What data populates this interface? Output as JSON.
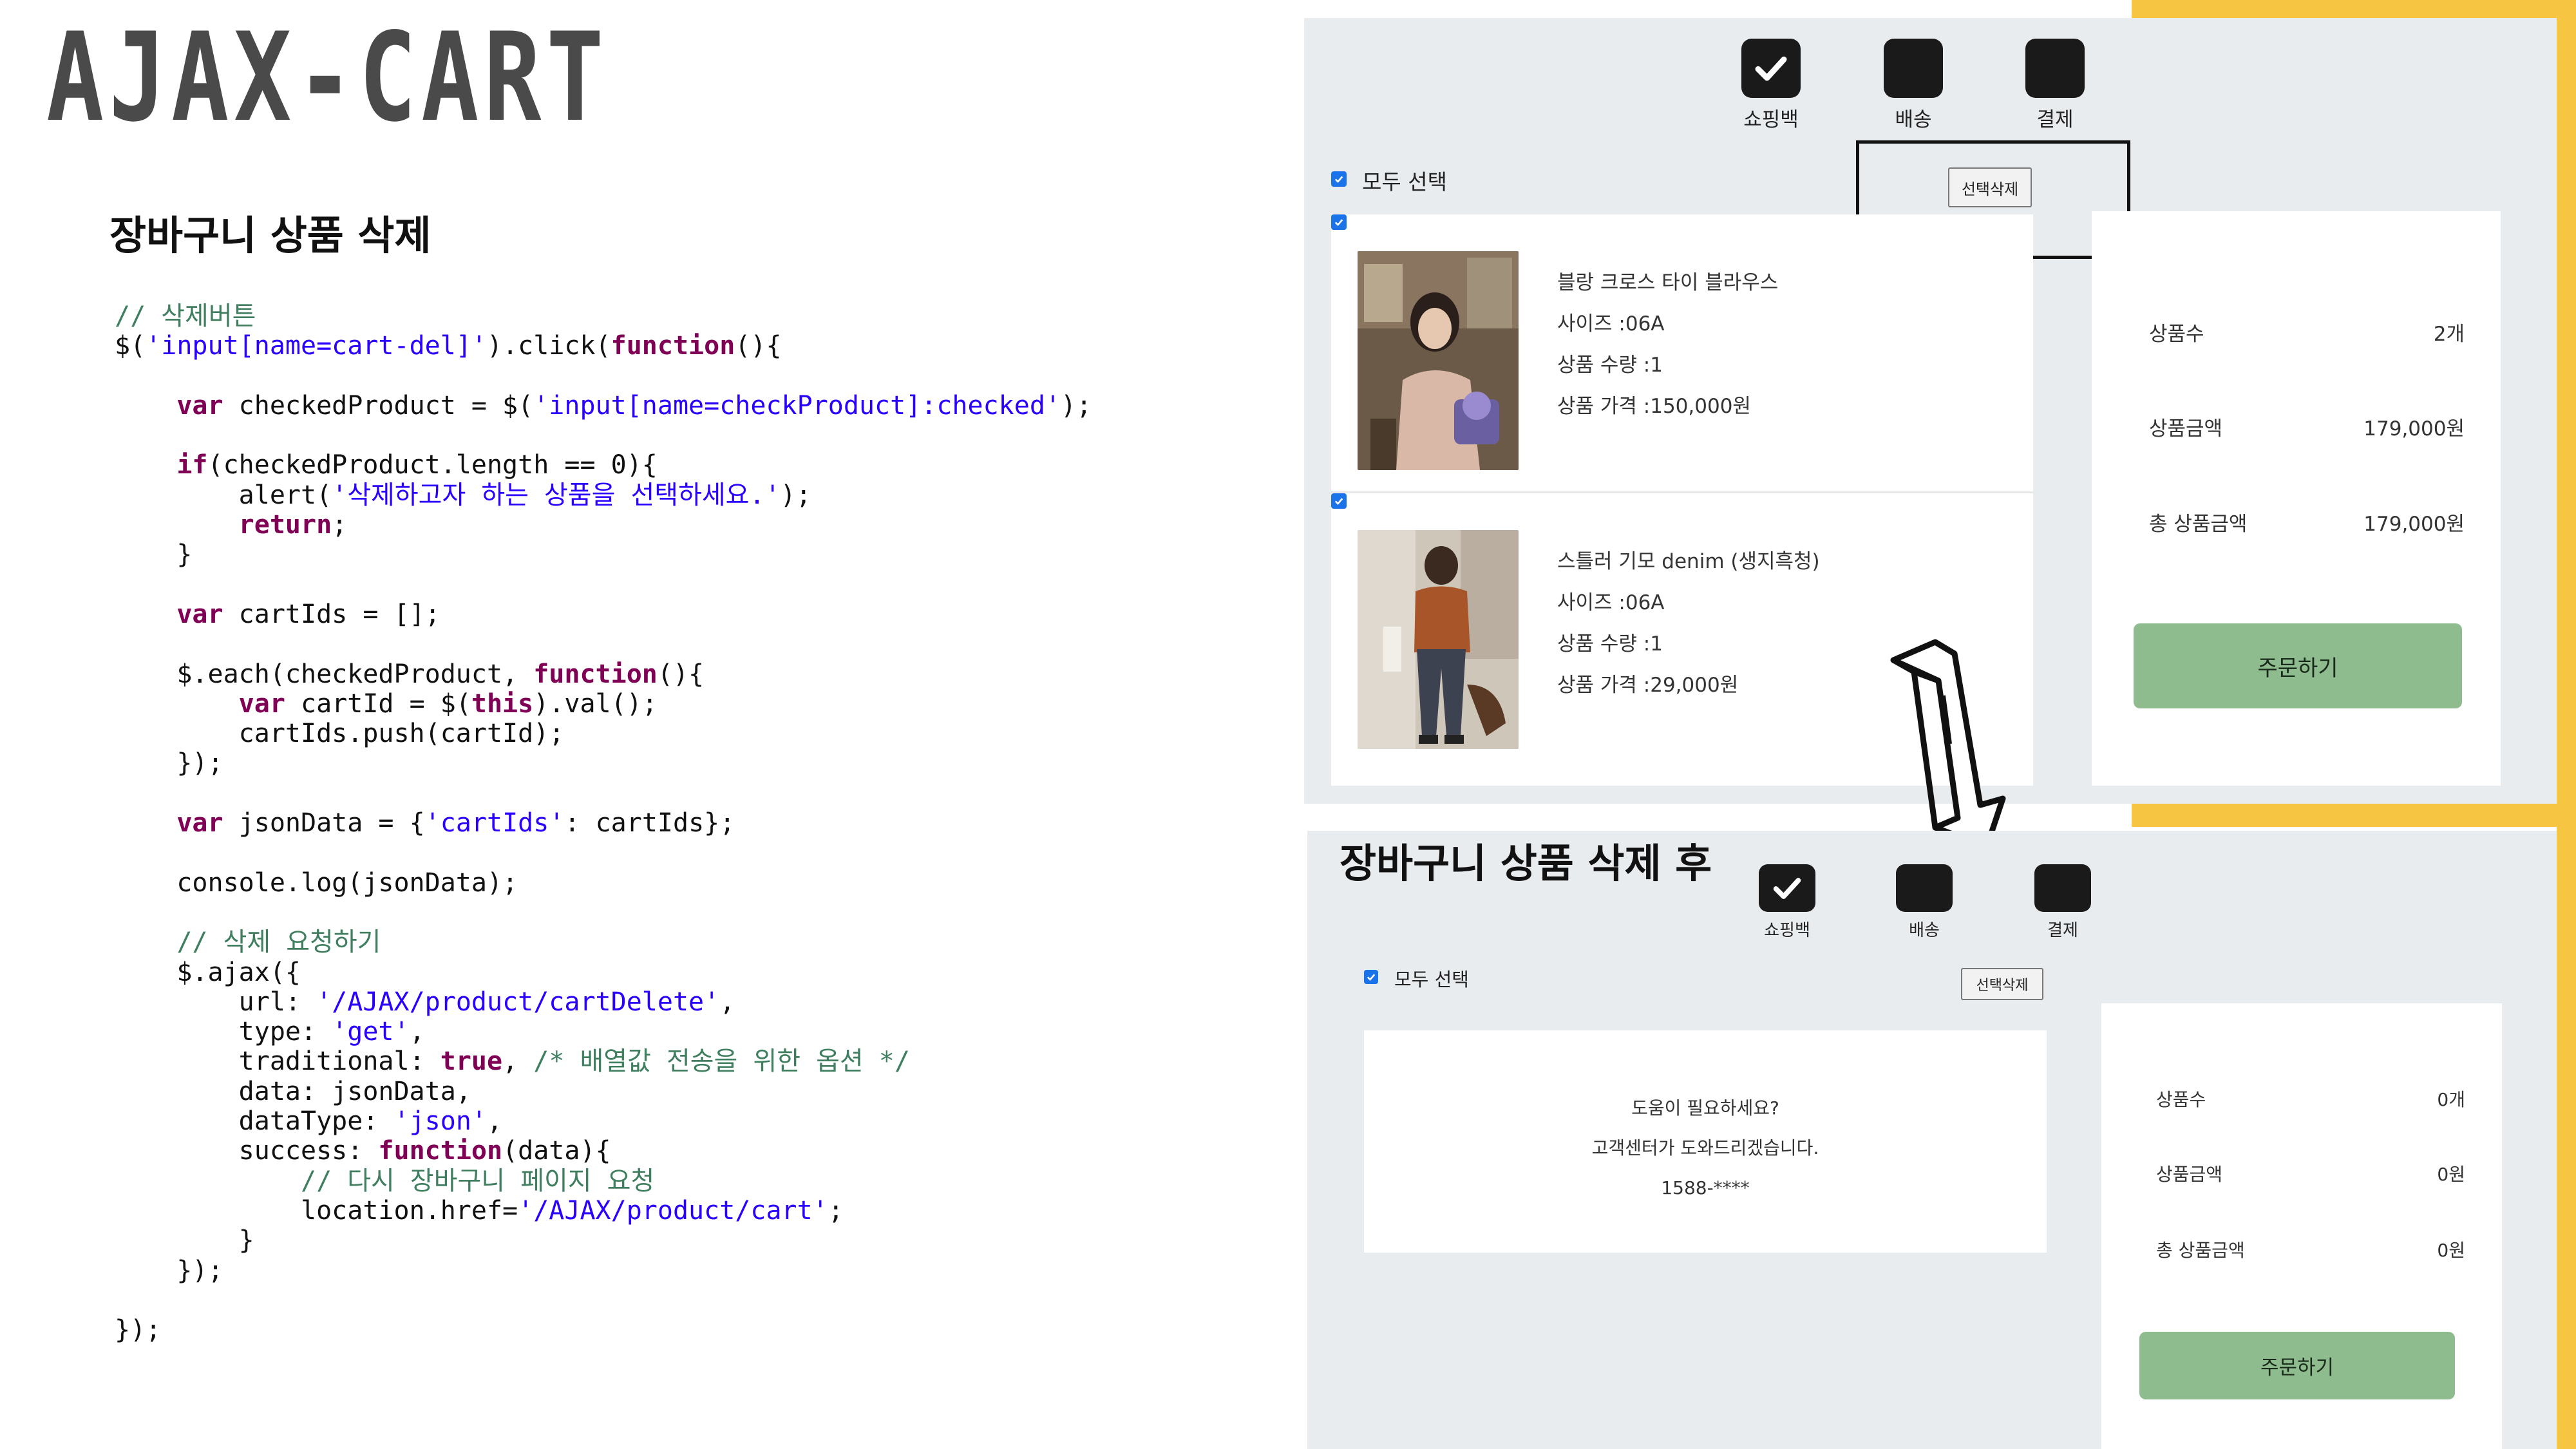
{
  "title": "AJAX-CART",
  "section_heading": "장바구니 상품 삭제",
  "code": [
    [
      [
        "cm",
        "// 삭제버튼"
      ]
    ],
    [
      [
        "pl",
        "$("
      ],
      [
        "str",
        "'input[name=cart-del]'"
      ],
      [
        "pl",
        ").click("
      ],
      [
        "kw",
        "function"
      ],
      [
        "pl",
        "(){"
      ]
    ],
    [
      [
        "pl",
        ""
      ]
    ],
    [
      [
        "pl",
        "    "
      ],
      [
        "kw",
        "var"
      ],
      [
        "pl",
        " checkedProduct = $("
      ],
      [
        "str",
        "'input[name=checkProduct]:checked'"
      ],
      [
        "pl",
        ");"
      ]
    ],
    [
      [
        "pl",
        ""
      ]
    ],
    [
      [
        "pl",
        "    "
      ],
      [
        "kw",
        "if"
      ],
      [
        "pl",
        "(checkedProduct.length == 0){"
      ]
    ],
    [
      [
        "pl",
        "        alert("
      ],
      [
        "str",
        "'삭제하고자 하는 상품을 선택하세요.'"
      ],
      [
        "pl",
        ");"
      ]
    ],
    [
      [
        "pl",
        "        "
      ],
      [
        "kw",
        "return"
      ],
      [
        "pl",
        ";"
      ]
    ],
    [
      [
        "pl",
        "    }"
      ]
    ],
    [
      [
        "pl",
        ""
      ]
    ],
    [
      [
        "pl",
        "    "
      ],
      [
        "kw",
        "var"
      ],
      [
        "pl",
        " cartIds = [];"
      ]
    ],
    [
      [
        "pl",
        ""
      ]
    ],
    [
      [
        "pl",
        "    $.each(checkedProduct, "
      ],
      [
        "kw",
        "function"
      ],
      [
        "pl",
        "(){"
      ]
    ],
    [
      [
        "pl",
        "        "
      ],
      [
        "kw",
        "var"
      ],
      [
        "pl",
        " cartId = $("
      ],
      [
        "kw",
        "this"
      ],
      [
        "pl",
        ").val();"
      ]
    ],
    [
      [
        "pl",
        "        cartIds.push(cartId);"
      ]
    ],
    [
      [
        "pl",
        "    });"
      ]
    ],
    [
      [
        "pl",
        ""
      ]
    ],
    [
      [
        "pl",
        "    "
      ],
      [
        "kw",
        "var"
      ],
      [
        "pl",
        " jsonData = {"
      ],
      [
        "str",
        "'cartIds'"
      ],
      [
        "pl",
        ": cartIds};"
      ]
    ],
    [
      [
        "pl",
        ""
      ]
    ],
    [
      [
        "pl",
        "    console.log(jsonData);"
      ]
    ],
    [
      [
        "pl",
        ""
      ]
    ],
    [
      [
        "cm",
        "    // 삭제 요청하기"
      ]
    ],
    [
      [
        "pl",
        "    $.ajax({"
      ]
    ],
    [
      [
        "pl",
        "        url: "
      ],
      [
        "str",
        "'/AJAX/product/cartDelete'"
      ],
      [
        "pl",
        ","
      ]
    ],
    [
      [
        "pl",
        "        type: "
      ],
      [
        "str",
        "'get'"
      ],
      [
        "pl",
        ","
      ]
    ],
    [
      [
        "pl",
        "        traditional: "
      ],
      [
        "kw",
        "true"
      ],
      [
        "pl",
        ", "
      ],
      [
        "cm",
        "/* 배열값 전송을 위한 옵션 */"
      ]
    ],
    [
      [
        "pl",
        "        data: jsonData,"
      ]
    ],
    [
      [
        "pl",
        "        dataType: "
      ],
      [
        "str",
        "'json'"
      ],
      [
        "pl",
        ","
      ]
    ],
    [
      [
        "pl",
        "        success: "
      ],
      [
        "kw",
        "function"
      ],
      [
        "pl",
        "(data){"
      ]
    ],
    [
      [
        "cm",
        "            // 다시 장바구니 페이지 요청"
      ]
    ],
    [
      [
        "pl",
        "            location.href="
      ],
      [
        "str",
        "'/AJAX/product/cart'"
      ],
      [
        "pl",
        ";"
      ]
    ],
    [
      [
        "pl",
        "        }"
      ]
    ],
    [
      [
        "pl",
        "    });"
      ]
    ],
    [
      [
        "pl",
        ""
      ]
    ],
    [
      [
        "pl",
        "});"
      ]
    ]
  ],
  "before": {
    "steps": [
      {
        "label": "쇼핑백",
        "active": true
      },
      {
        "label": "배송",
        "active": false
      },
      {
        "label": "결제",
        "active": false
      }
    ],
    "select_all_label": "모두 선택",
    "delete_button": "선택삭제",
    "products": [
      {
        "name": "블랑 크로스 타이 블라우스",
        "size": "사이즈 :06A",
        "qty": "상품 수량 :1",
        "price": "상품 가격 :150,000원"
      },
      {
        "name": "스틀러 기모 denim (생지흑청)",
        "size": "사이즈 :06A",
        "qty": "상품 수량 :1",
        "price": "상품 가격 :29,000원"
      }
    ],
    "summary": [
      {
        "label": "상품수",
        "value": "2개"
      },
      {
        "label": "상품금액",
        "value": "179,000원"
      },
      {
        "label": "총 상품금액",
        "value": "179,000원"
      }
    ],
    "order_button": "주문하기"
  },
  "after": {
    "heading": "장바구니 상품 삭제 후",
    "steps": [
      {
        "label": "쇼핑백",
        "active": true
      },
      {
        "label": "배송",
        "active": false
      },
      {
        "label": "결제",
        "active": false
      }
    ],
    "select_all_label": "모두 선택",
    "delete_button": "선택삭제",
    "help": {
      "line1": "도움이 필요하세요?",
      "line2": "고객센터가 도와드리겠습니다.",
      "line3": "1588-****"
    },
    "summary": [
      {
        "label": "상품수",
        "value": "0개"
      },
      {
        "label": "상품금액",
        "value": "0원"
      },
      {
        "label": "총 상품금액",
        "value": "0원"
      }
    ],
    "order_button": "주문하기"
  },
  "colors": {
    "accent_yellow": "#f6c643",
    "panel_bg": "#e9ecef",
    "order_button": "#8fbc8f",
    "checkbox": "#1a73e8"
  },
  "icons": {
    "step_check": "check-icon",
    "arrow": "arrow-down-icon"
  }
}
